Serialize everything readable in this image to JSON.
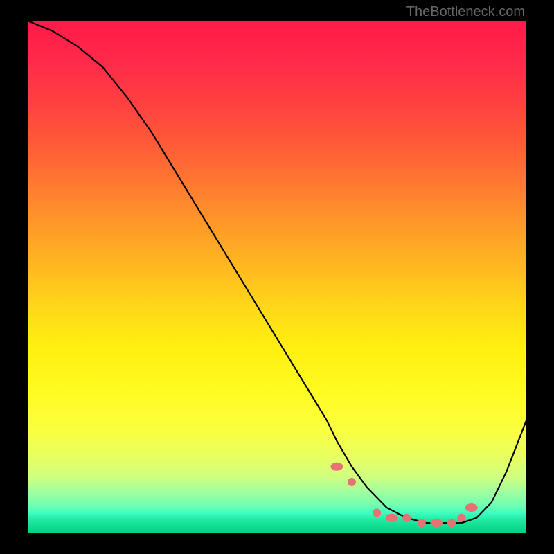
{
  "watermark": "TheBottleneck.com",
  "chart_data": {
    "type": "line",
    "title": "",
    "xlabel": "",
    "ylabel": "",
    "xlim": [
      0,
      100
    ],
    "ylim": [
      0,
      100
    ],
    "background": "red-yellow-green vertical gradient (bottleneck heatmap)",
    "series": [
      {
        "name": "bottleneck-curve",
        "color": "#000000",
        "x": [
          0,
          5,
          10,
          15,
          20,
          25,
          30,
          35,
          40,
          45,
          50,
          55,
          60,
          62,
          65,
          68,
          72,
          76,
          80,
          84,
          87,
          90,
          93,
          96,
          100
        ],
        "y": [
          100,
          98,
          95,
          91,
          85,
          78,
          70,
          62,
          54,
          46,
          38,
          30,
          22,
          18,
          13,
          9,
          5,
          3,
          2,
          2,
          2,
          3,
          6,
          12,
          22
        ]
      },
      {
        "name": "highlight-points",
        "color": "#e57373",
        "type": "scatter",
        "x": [
          62,
          65,
          70,
          73,
          76,
          79,
          82,
          85,
          87,
          89
        ],
        "y": [
          13,
          10,
          4,
          3,
          3,
          2,
          2,
          2,
          3,
          5
        ]
      }
    ]
  }
}
